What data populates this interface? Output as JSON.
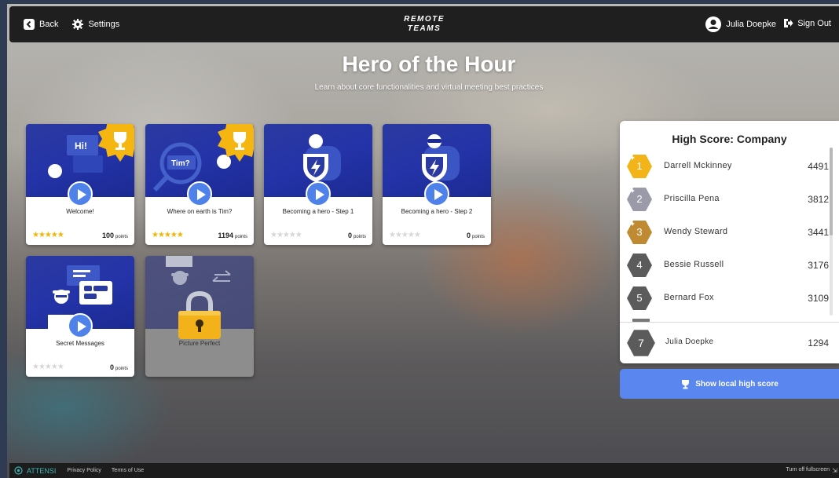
{
  "header": {
    "back_label": "Back",
    "settings_label": "Settings",
    "brand_line1": "REMOTE",
    "brand_line2": "TEAMS",
    "user_name": "Julia Doepke",
    "signout_label": "Sign Out"
  },
  "page": {
    "title": "Hero of the Hour",
    "subtitle": "Learn about core functionalities and virtual meeting best practices"
  },
  "modules": [
    {
      "name": "Welcome!",
      "stars": 5,
      "points": "100",
      "points_unit": "points",
      "art_text": "Hi!",
      "badge": "trophy-badge"
    },
    {
      "name": "Where on earth is Tim?",
      "stars": 5,
      "points": "1194",
      "points_unit": "points",
      "art_text": "Tim?",
      "badge": "trophy-badge"
    },
    {
      "name": "Becoming a hero - Step 1",
      "stars": 0,
      "points": "0",
      "points_unit": "points"
    },
    {
      "name": "Becoming a hero - Step 2",
      "stars": 0,
      "points": "0",
      "points_unit": "points"
    },
    {
      "name": "Secret Messages",
      "stars": 0,
      "points": "0",
      "points_unit": "points"
    },
    {
      "name": "Picture Perfect",
      "locked": true
    }
  ],
  "highscore": {
    "title": "High Score: Company",
    "rows": [
      {
        "rank": "1",
        "name": "Darrell Mckinney",
        "score": "4491",
        "color": "#f2b418"
      },
      {
        "rank": "2",
        "name": "Priscilla Pena",
        "score": "3812",
        "color": "#9a9aa8"
      },
      {
        "rank": "3",
        "name": "Wendy Steward",
        "score": "3441",
        "color": "#c08a32"
      },
      {
        "rank": "4",
        "name": "Bessie Russell",
        "score": "3176",
        "color": "#5b5b5b"
      },
      {
        "rank": "5",
        "name": "Bernard Fox",
        "score": "3109",
        "color": "#5b5b5b"
      }
    ],
    "me": {
      "rank": "7",
      "name": "Julia Doepke",
      "score": "1294",
      "color": "#5b5b5b"
    }
  },
  "local_button_label": "Show local high score",
  "footer": {
    "brand": "ATTENSI",
    "privacy": "Privacy Policy",
    "terms": "Terms of Use",
    "fullscreen": "Turn off fullscreen"
  },
  "colors": {
    "accent": "#5a86ef",
    "card_art": "#2433a8",
    "star": "#f5b400"
  }
}
